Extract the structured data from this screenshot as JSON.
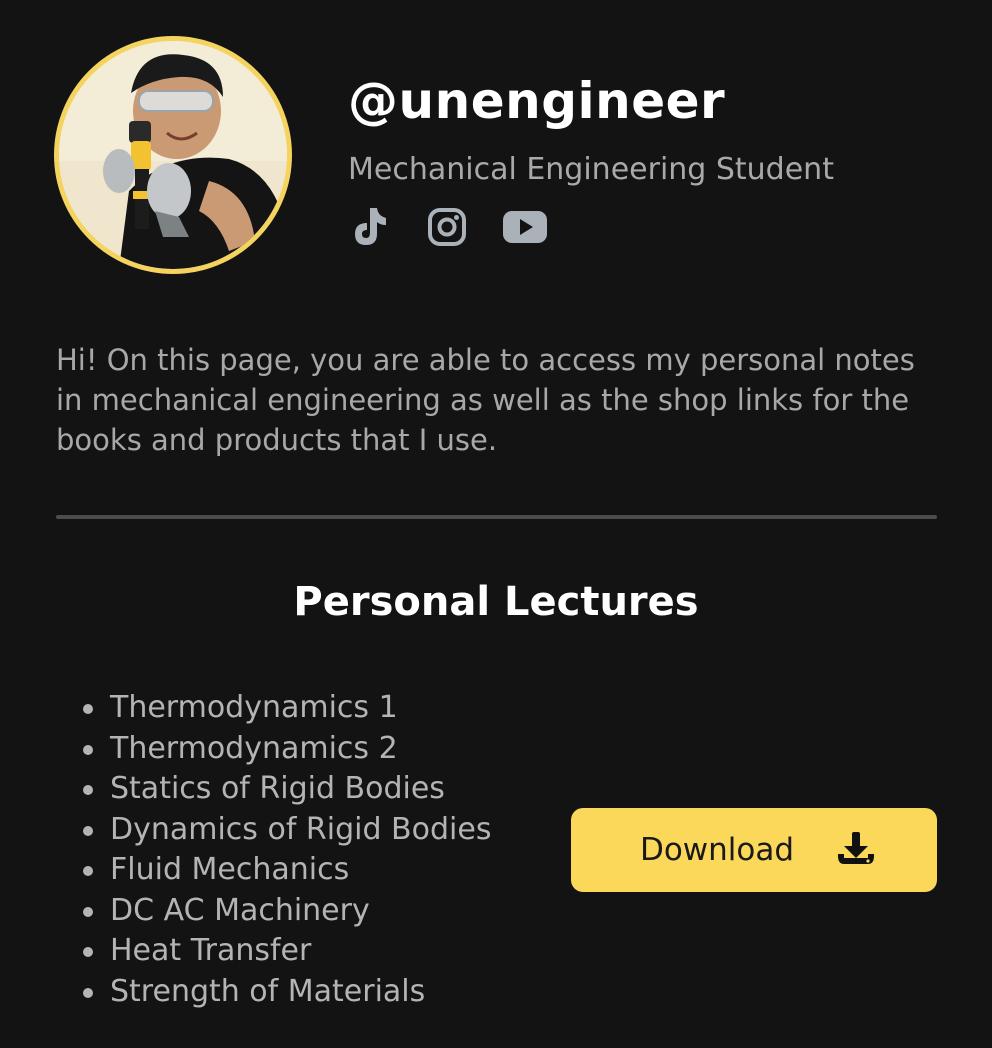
{
  "profile": {
    "handle": "@unengineer",
    "subtitle": "Mechanical Engineering Student",
    "avatar_alt": "Profile photo",
    "socials": [
      {
        "name": "TikTok",
        "icon": "tiktok-icon"
      },
      {
        "name": "Instagram",
        "icon": "instagram-icon"
      },
      {
        "name": "YouTube",
        "icon": "youtube-icon"
      }
    ]
  },
  "bio": "Hi! On this page, you are able to access my personal notes in mechanical engineering as well as the shop links for the books and products that I use.",
  "lectures": {
    "title": "Personal Lectures",
    "items": [
      "Thermodynamics 1",
      "Thermodynamics 2",
      "Statics of Rigid Bodies",
      "Dynamics of Rigid Bodies",
      "Fluid Mechanics",
      "DC AC Machinery",
      "Heat Transfer",
      "Strength of Materials"
    ],
    "download_label": "Download",
    "download_icon": "download-icon"
  },
  "colors": {
    "background": "#131313",
    "accent": "#fbd85a",
    "avatar_ring": "#f4d35e",
    "divider": "#4c4c4c",
    "icon": "#aab1b8"
  }
}
